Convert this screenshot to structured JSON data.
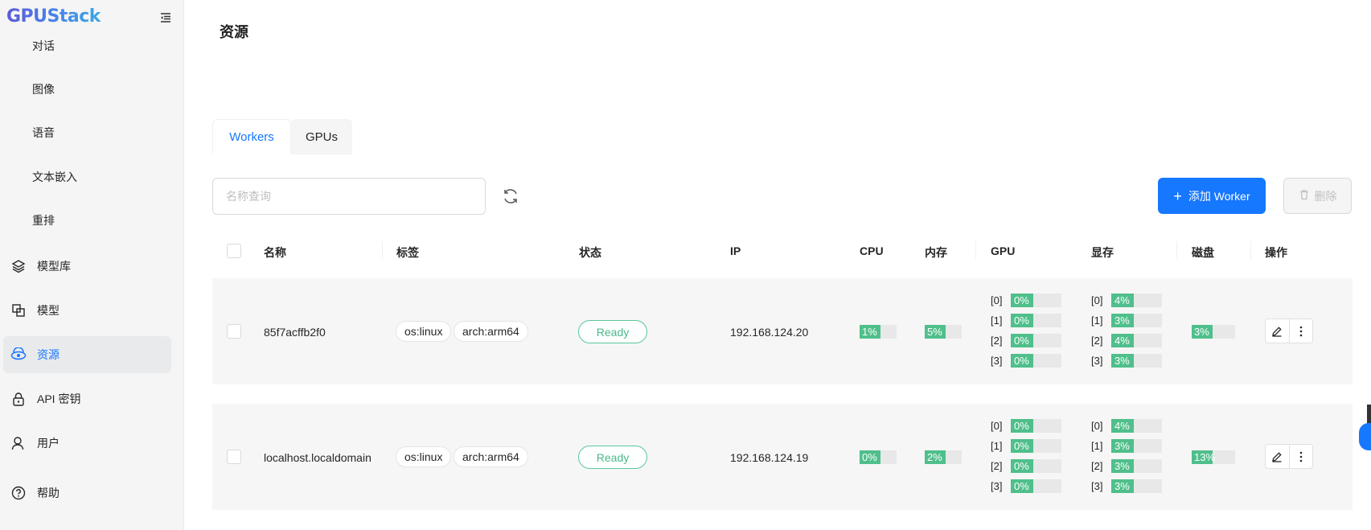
{
  "app": {
    "logo": "GPUStack"
  },
  "sidebar": {
    "sub_items": [
      "对话",
      "图像",
      "语音",
      "文本嵌入",
      "重排"
    ],
    "items": [
      {
        "label": "模型库",
        "icon": "layers-icon"
      },
      {
        "label": "模型",
        "icon": "model-icon"
      },
      {
        "label": "资源",
        "icon": "resources-icon",
        "active": true
      },
      {
        "label": "API 密钥",
        "icon": "lock-icon"
      },
      {
        "label": "用户",
        "icon": "user-icon"
      },
      {
        "label": "帮助",
        "icon": "help-icon"
      }
    ]
  },
  "page": {
    "title": "资源"
  },
  "tabs": [
    {
      "label": "Workers",
      "active": true
    },
    {
      "label": "GPUs",
      "active": false
    }
  ],
  "toolbar": {
    "search_placeholder": "名称查询",
    "add_label": "添加 Worker",
    "delete_label": "删除"
  },
  "table": {
    "headers": {
      "name": "名称",
      "labels": "标签",
      "status": "状态",
      "ip": "IP",
      "cpu": "CPU",
      "memory": "内存",
      "gpu": "GPU",
      "vram": "显存",
      "disk": "磁盘",
      "actions": "操作"
    },
    "rows": [
      {
        "name": "85f7acffb2f0",
        "tags": [
          "os:linux",
          "arch:arm64"
        ],
        "status": "Ready",
        "ip": "192.168.124.20",
        "cpu": "1%",
        "cpu_value": 1,
        "memory": "5%",
        "memory_value": 5,
        "gpu": [
          {
            "idx": "[0]",
            "val": "0%"
          },
          {
            "idx": "[1]",
            "val": "0%"
          },
          {
            "idx": "[2]",
            "val": "0%"
          },
          {
            "idx": "[3]",
            "val": "0%"
          }
        ],
        "vram": [
          {
            "idx": "[0]",
            "val": "4%"
          },
          {
            "idx": "[1]",
            "val": "3%"
          },
          {
            "idx": "[2]",
            "val": "4%"
          },
          {
            "idx": "[3]",
            "val": "3%"
          }
        ],
        "disk": "3%",
        "disk_value": 3
      },
      {
        "name": "localhost.localdomain",
        "tags": [
          "os:linux",
          "arch:arm64"
        ],
        "status": "Ready",
        "ip": "192.168.124.19",
        "cpu": "0%",
        "cpu_value": 0,
        "memory": "2%",
        "memory_value": 2,
        "gpu": [
          {
            "idx": "[0]",
            "val": "0%"
          },
          {
            "idx": "[1]",
            "val": "0%"
          },
          {
            "idx": "[2]",
            "val": "0%"
          },
          {
            "idx": "[3]",
            "val": "0%"
          }
        ],
        "vram": [
          {
            "idx": "[0]",
            "val": "4%"
          },
          {
            "idx": "[1]",
            "val": "3%"
          },
          {
            "idx": "[2]",
            "val": "3%"
          },
          {
            "idx": "[3]",
            "val": "3%"
          }
        ],
        "disk": "13%",
        "disk_value": 13
      }
    ]
  },
  "colors": {
    "accent": "#1677ff",
    "ok": "#4fbf8b"
  }
}
